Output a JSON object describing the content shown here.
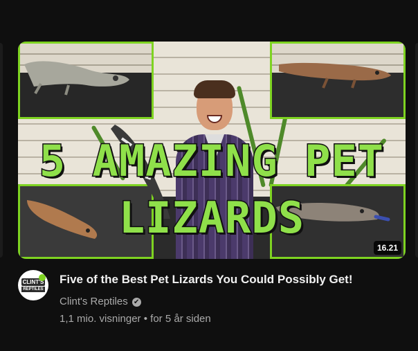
{
  "thumbnail": {
    "overlay_line1": "5 AMAZING PET",
    "overlay_line2": "LIZARDS",
    "duration": "16.21",
    "accent_color": "#7ed321"
  },
  "channel_avatar": {
    "line1": "CLINT'S",
    "line2": "REPTILES"
  },
  "video": {
    "title": "Five of the Best Pet Lizards You Could Possibly Get!",
    "channel_name": "Clint's Reptiles",
    "verified_icon": "✔",
    "views": "1,1 mio. visninger",
    "separator": "•",
    "age": "for 5 år siden"
  },
  "icons": [
    "verified-check-icon"
  ]
}
